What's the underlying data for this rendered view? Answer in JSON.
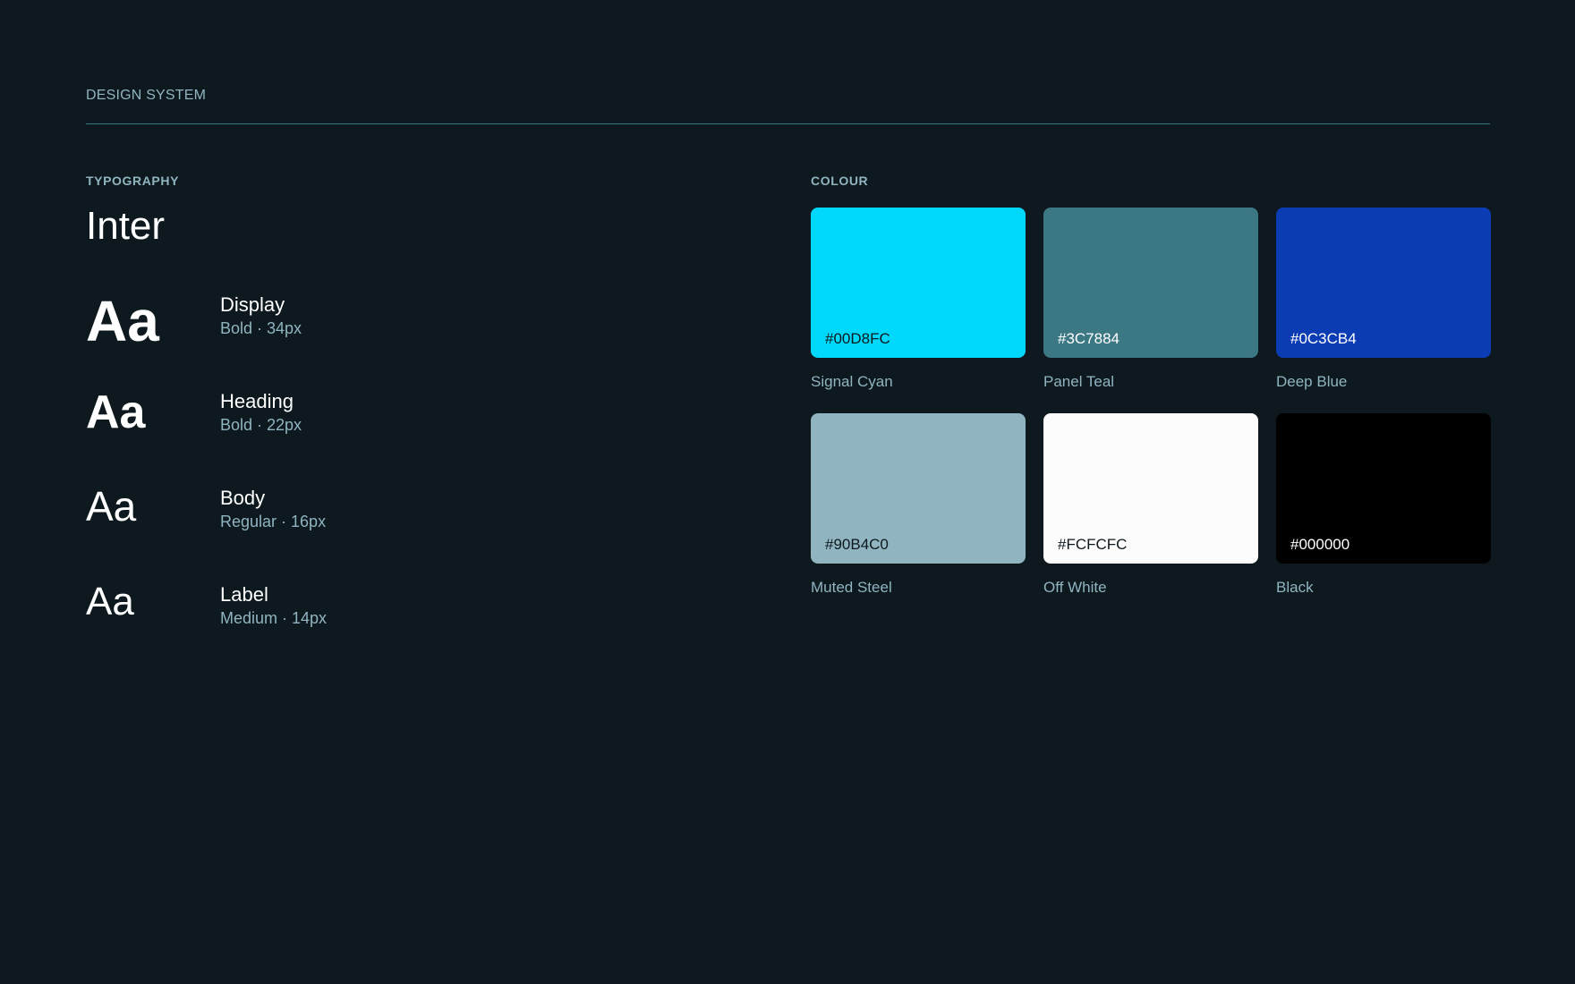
{
  "header": {
    "title": "DESIGN SYSTEM"
  },
  "typography": {
    "label": "TYPOGRAPHY",
    "typeface": "Inter",
    "styles": [
      {
        "sample": "Aa",
        "name": "Display",
        "spec": "Bold · 34px"
      },
      {
        "sample": "Aa",
        "name": "Heading",
        "spec": "Bold · 22px"
      },
      {
        "sample": "Aa",
        "name": "Body",
        "spec": "Regular · 16px"
      },
      {
        "sample": "Aa",
        "name": "Label",
        "spec": "Medium · 14px"
      }
    ]
  },
  "colour": {
    "label": "COLOUR",
    "swatches": [
      {
        "hex": "#00D8FC",
        "name": "Signal Cyan",
        "text_color": "#0d191e"
      },
      {
        "hex": "#3C7884",
        "name": "Panel Teal",
        "text_color": "#ffffff"
      },
      {
        "hex": "#0C3CB4",
        "name": "Deep Blue",
        "text_color": "#ffffff"
      },
      {
        "hex": "#90B4C0",
        "name": "Muted Steel",
        "text_color": "#0d191e"
      },
      {
        "hex": "#FCFCFC",
        "name": "Off White",
        "text_color": "#0d191e"
      },
      {
        "hex": "#000000",
        "name": "Black",
        "text_color": "#ffffff"
      }
    ]
  },
  "theme": {
    "background": "#0d191e",
    "muted_text": "#90b4c0",
    "rule": "#3c7884"
  }
}
